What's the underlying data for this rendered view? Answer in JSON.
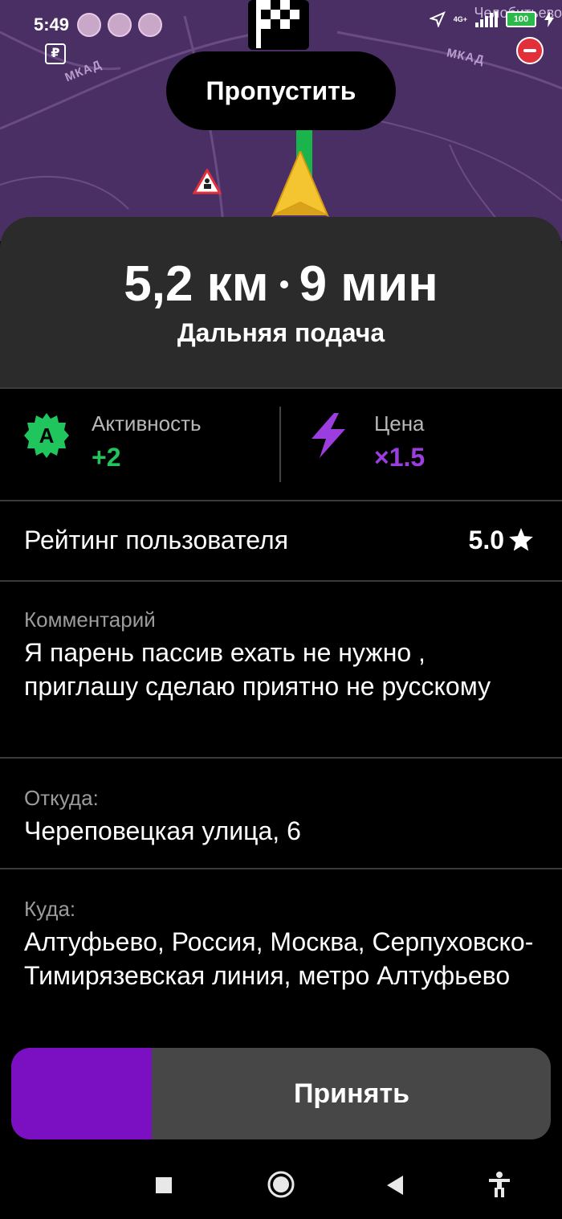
{
  "status_bar": {
    "time": "5:49",
    "network": "4G+",
    "battery": "100",
    "district": "Челобитьево",
    "ruble_icon": "ruble-icon"
  },
  "map": {
    "road_labels": [
      "МКАД",
      "МКАД"
    ],
    "skip_label": "Пропустить",
    "colors": {
      "map_bg": "#4a2f64",
      "route": "#1ab34c",
      "arrow": "#f4c530"
    }
  },
  "trip": {
    "distance": "5,2 км",
    "duration": "9 мин",
    "subtitle": "Дальняя подача"
  },
  "stats": {
    "activity_label": "Активность",
    "activity_value": "+2",
    "activity_badge": "А",
    "price_label": "Цена",
    "price_value": "×1.5",
    "colors": {
      "activity": "#21c55d",
      "price": "#9c3ddf"
    }
  },
  "rating": {
    "label": "Рейтинг пользователя",
    "value": "5.0"
  },
  "comment": {
    "caption": "Комментарий",
    "text": "Я парень пассив ехать не нужно , приглашу сделаю приятно не русскому"
  },
  "from": {
    "caption": "Откуда:",
    "text": "Череповецкая улица, 6"
  },
  "to": {
    "caption": "Куда:",
    "text": "Алтуфьево, Россия, Москва, Серпуховско-Тимирязевская линия, метро Алтуфьево"
  },
  "accept": {
    "label": "Принять",
    "progress": 0.26,
    "colors": {
      "fill": "#7a10c2",
      "track": "#474747"
    }
  },
  "nav_icons": [
    "square-icon",
    "home-circle-icon",
    "back-triangle-icon",
    "accessibility-icon"
  ]
}
